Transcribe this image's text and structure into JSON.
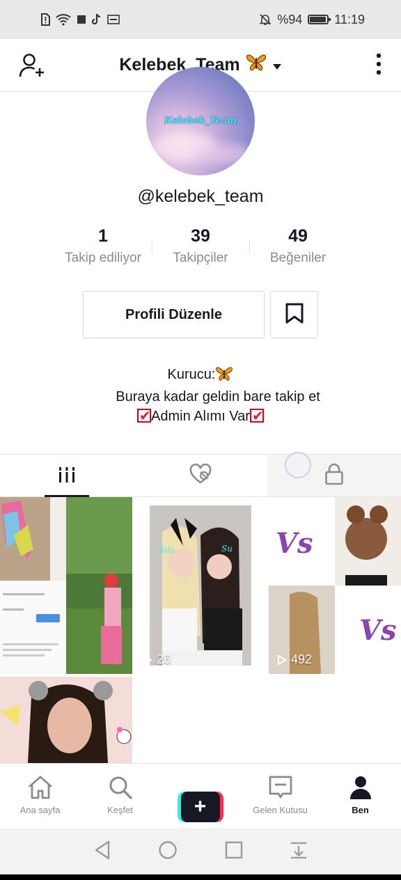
{
  "statusbar": {
    "battery_text": "%94",
    "battery_level": 0.94,
    "time": "11:19"
  },
  "header": {
    "title": "Kelebek_Team",
    "title_emoji_icon": "butterfly-icon"
  },
  "profile": {
    "avatar_text": "Kelebek_Team",
    "username": "@kelebek_team",
    "stats": [
      {
        "value": "1",
        "label": "Takip ediliyor"
      },
      {
        "value": "39",
        "label": "Takipçiler"
      },
      {
        "value": "49",
        "label": "Beğeniler"
      }
    ],
    "edit_button": "Profili Düzenle",
    "bio": {
      "line1": "Kurucu:",
      "line2": "Buraya kadar geldin bare takip et",
      "line3": "Admin Alımı Var"
    }
  },
  "videos": [
    {
      "views": ""
    },
    {
      "views": "26"
    },
    {
      "views": "492"
    },
    {
      "views": ""
    }
  ],
  "bottom_nav": [
    {
      "label": "Ana sayfa",
      "icon": "home-icon"
    },
    {
      "label": "Keşfet",
      "icon": "search-icon"
    },
    {
      "label": "",
      "icon": "plus-icon"
    },
    {
      "label": "Gelen Kutusu",
      "icon": "inbox-icon"
    },
    {
      "label": "Ben",
      "icon": "profile-icon"
    }
  ],
  "colors": {
    "accent_red": "#fe2c55",
    "accent_cyan": "#25f4ee",
    "text_primary": "#161823",
    "text_secondary": "#8a8b91"
  }
}
